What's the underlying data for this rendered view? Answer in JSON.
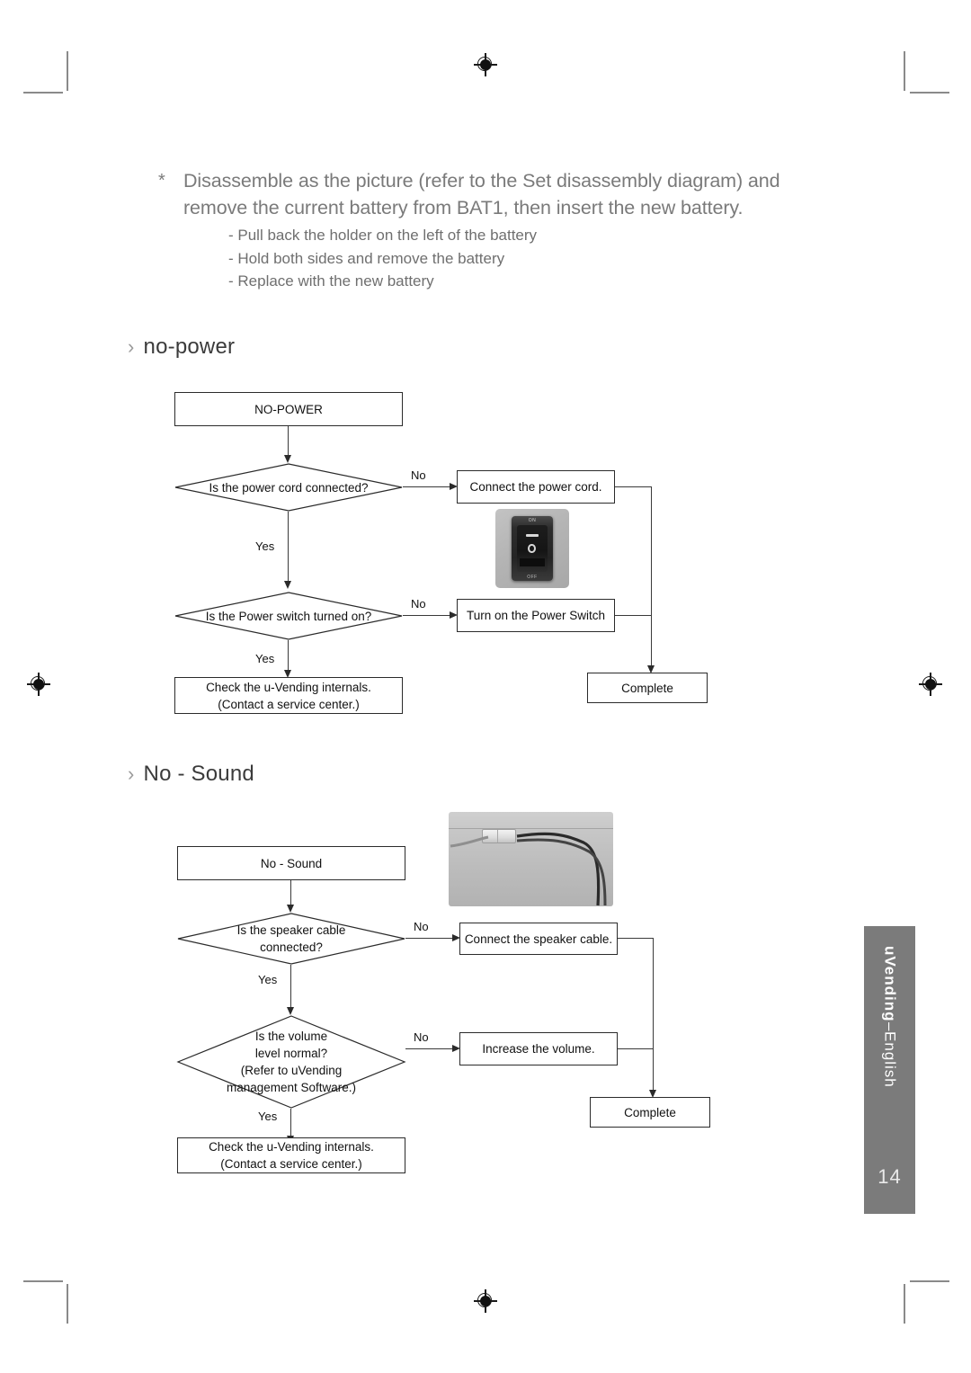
{
  "intro": {
    "bullet_marker": "*",
    "main_text": "Disassemble as the picture (refer to the Set disassembly diagram) and remove the current battery from BAT1, then insert the new battery.",
    "sub_items": [
      "- Pull back the holder on the left of the battery",
      "- Hold both sides and remove the battery",
      "- Replace with the new battery"
    ]
  },
  "sections": [
    {
      "chevron": "›",
      "title": "no-power"
    },
    {
      "chevron": "›",
      "title": "No - Sound"
    }
  ],
  "flowchart_no_power": {
    "start": "NO-POWER",
    "decision_1": "Is the power cord connected?",
    "decision_1_no": "No",
    "decision_1_yes": "Yes",
    "action_1": "Connect the power cord.",
    "decision_2": "Is the Power switch turned on?",
    "decision_2_no": "No",
    "decision_2_yes": "Yes",
    "action_2": "Turn on the Power Switch",
    "terminal_check_line1": "Check the u-Vending internals.",
    "terminal_check_line2": "(Contact a service center.)",
    "complete": "Complete",
    "photo_caption": "power-switch-photo",
    "photo_on_label": "ON",
    "photo_off_label": "OFF"
  },
  "flowchart_no_sound": {
    "start": "No - Sound",
    "decision_1_line1": "Is the speaker cable",
    "decision_1_line2": "connected?",
    "decision_1_no": "No",
    "decision_1_yes": "Yes",
    "action_1": "Connect the speaker cable.",
    "decision_2_line1": "Is the volume",
    "decision_2_line2": "level normal?",
    "decision_2_line3": "(Refer to uVending",
    "decision_2_line4": "management  Software.)",
    "decision_2_no": "No",
    "decision_2_yes": "Yes",
    "action_2": "Increase the volume.",
    "terminal_check_line1": "Check the u-Vending internals.",
    "terminal_check_line2": "(Contact a service center.)",
    "complete": "Complete",
    "photo_caption": "speaker-cable-photo"
  },
  "side_tab": {
    "brand": "uVending",
    "separator": "–",
    "language": "English",
    "page_number": "14",
    "background_color": "#7b7b7b"
  },
  "colors": {
    "intro_text": "#7a7a7a",
    "heading_text": "#3b3b3b",
    "flow_line": "#2b2b2b",
    "tab_gray": "#7b7b7b"
  }
}
